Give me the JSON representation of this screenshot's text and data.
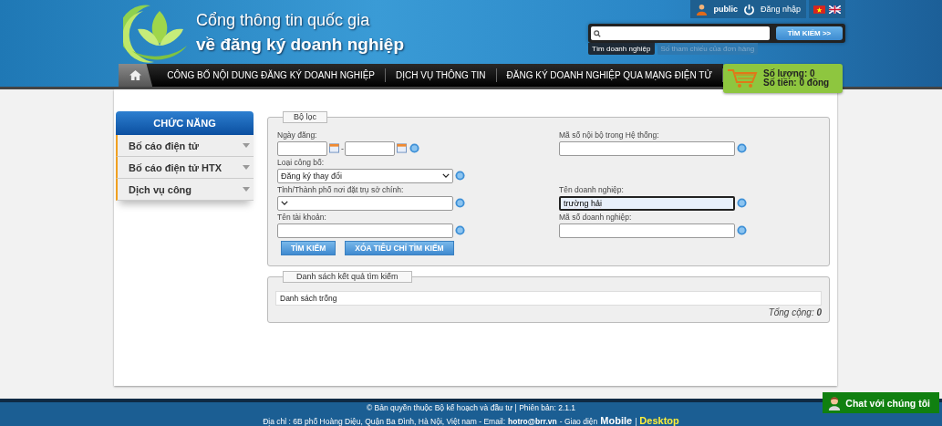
{
  "header": {
    "title_line1": "Cổng thông tin quốc gia",
    "title_line2": "về đăng ký doanh nghiệp"
  },
  "user_bar": {
    "username": "public",
    "login": "Đăng nhập"
  },
  "search": {
    "button": "TÌM KIẾM >>",
    "tabs": [
      {
        "label": "Tìm doanh nghiệp",
        "selected": true
      },
      {
        "label": "Số tham chiếu của đơn hàng",
        "selected": false
      }
    ]
  },
  "nav": {
    "items": [
      "CÔNG BỐ NỘI DUNG ĐĂNG KÝ DOANH NGHIỆP",
      "DỊCH VỤ THÔNG TIN",
      "ĐĂNG KÝ DOANH NGHIỆP QUA MẠNG ĐIỆN TỬ"
    ]
  },
  "cart": {
    "quantity": "Số lượng: 0",
    "amount": "Số tiền: 0 đồng"
  },
  "sidebar": {
    "title": "CHỨC NĂNG",
    "items": [
      "Bố cáo điện tử",
      "Bố cáo điện tử HTX",
      "Dịch vụ công"
    ]
  },
  "filter": {
    "legend": "Bộ lọc",
    "rows": [
      {
        "left": {
          "kind": "date_range",
          "label": "Ngày đăng:",
          "separator": "-"
        },
        "right": {
          "kind": "text",
          "label": "Mã số nội bộ trong Hệ thống:"
        }
      },
      {
        "left": {
          "kind": "select",
          "label": "Loại công bố:",
          "value": "Đăng ký thay đổi"
        }
      },
      {
        "left": {
          "kind": "select",
          "label": "Tỉnh/Thành phố nơi đặt trụ sở chính:"
        },
        "right": {
          "kind": "text",
          "label": "Tên doanh nghiệp:",
          "value": "trường hải",
          "focused": true
        }
      },
      {
        "left": {
          "kind": "text",
          "label": "Tên tài khoản:"
        },
        "right": {
          "kind": "text",
          "label": "Mã số doanh nghiệp:"
        }
      }
    ],
    "buttons": [
      "TÌM KIẾM",
      "XÓA TIÊU CHÍ TÌM KIẾM"
    ]
  },
  "results": {
    "legend": "Danh sách kết quả tìm kiếm",
    "empty_text": "Danh sách trống",
    "total": "Tổng cộng: **0**"
  },
  "footer": {
    "copyright": "© Bản quyền thuộc Bộ kế hoạch và đầu tư | Phiên bản: 2.1.1",
    "address": "Địa chỉ : 6B phố Hoàng Diệu, Quận Ba Đình, Hà Nội, Việt nam - Email:",
    "email": "hotro@brr.vn",
    "interface_label": "- Giao diện",
    "separator": "|",
    "interfaces": [
      {
        "label": "Mobile",
        "selected": false
      },
      {
        "label": "Desktop",
        "selected": true
      }
    ]
  },
  "chat": {
    "label": "Chat với chúng tôi"
  }
}
